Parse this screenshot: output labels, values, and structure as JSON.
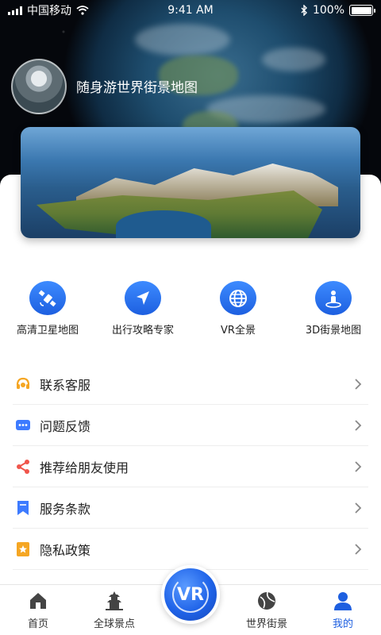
{
  "status_bar": {
    "carrier": "中国移动",
    "time": "9:41 AM",
    "battery": "100%",
    "battery_level": 1.0
  },
  "profile": {
    "app_name": "随身游世界街景地图"
  },
  "features": [
    {
      "label": "高清卫星地图",
      "icon": "satellite-icon"
    },
    {
      "label": "出行攻略专家",
      "icon": "navigation-arrow-icon"
    },
    {
      "label": "VR全景",
      "icon": "globe-icon"
    },
    {
      "label": "3D街景地图",
      "icon": "person-pin-icon"
    }
  ],
  "menu": [
    {
      "label": "联系客服",
      "icon": "headset-icon",
      "color": "#f5a623"
    },
    {
      "label": "问题反馈",
      "icon": "chat-bubble-icon",
      "color": "#3d7bff"
    },
    {
      "label": "推荐给朋友使用",
      "icon": "share-icon",
      "color": "#f0554b"
    },
    {
      "label": "服务条款",
      "icon": "bookmark-icon",
      "color": "#3d7bff"
    },
    {
      "label": "隐私政策",
      "icon": "star-badge-icon",
      "color": "#f5a623"
    }
  ],
  "tabbar": {
    "tabs": [
      {
        "label": "首页",
        "icon": "home-icon",
        "active": false
      },
      {
        "label": "全球景点",
        "icon": "pagoda-icon",
        "active": false
      },
      {
        "label": "世界街景",
        "icon": "globe-ball-icon",
        "active": false
      },
      {
        "label": "我的",
        "icon": "user-icon",
        "active": true
      }
    ],
    "center_button": "VR"
  },
  "colors": {
    "accent": "#1d5fe0",
    "text": "#222222"
  }
}
